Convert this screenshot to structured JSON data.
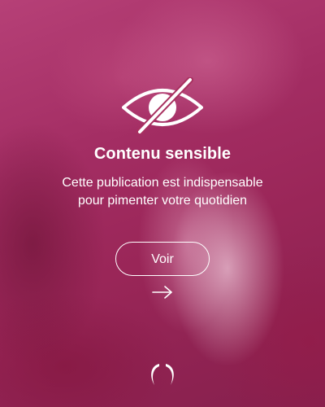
{
  "notice": {
    "icon": "eye-slash-icon",
    "title": "Contenu sensible",
    "subtitle_line1": "Cette publication est indispensable",
    "subtitle_line2": "pour pimenter votre quotidien"
  },
  "actions": {
    "view_label": "Voir",
    "arrow_icon": "arrow-right-icon"
  },
  "footer": {
    "logo_icon": "brand-logo-icon"
  },
  "colors": {
    "background_base": "#a32d63",
    "foreground": "#ffffff"
  }
}
